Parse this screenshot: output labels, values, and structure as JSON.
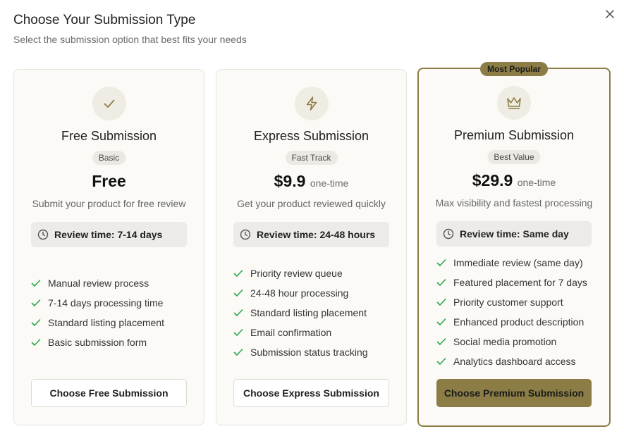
{
  "dialog": {
    "title": "Choose Your Submission Type",
    "subtitle": "Select the submission option that best fits your needs",
    "close_icon": "close-icon"
  },
  "colors": {
    "accent": "#8b7d45",
    "check": "#2aa84a",
    "card_bg": "#fbfaf7"
  },
  "plans": [
    {
      "icon": "check-icon",
      "name": "Free Submission",
      "badge": "Basic",
      "price": "Free",
      "price_suffix": "",
      "description": "Submit your product for free review",
      "review_time": "Review time: 7-14 days",
      "features": [
        "Manual review process",
        "7-14 days processing time",
        "Standard listing placement",
        "Basic submission form"
      ],
      "cta": "Choose Free Submission"
    },
    {
      "icon": "lightning-icon",
      "name": "Express Submission",
      "badge": "Fast Track",
      "price": "$9.9",
      "price_suffix": "one-time",
      "description": "Get your product reviewed quickly",
      "review_time": "Review time: 24-48 hours",
      "features": [
        "Priority review queue",
        "24-48 hour processing",
        "Standard listing placement",
        "Email confirmation",
        "Submission status tracking"
      ],
      "cta": "Choose Express Submission"
    },
    {
      "icon": "crown-icon",
      "name": "Premium Submission",
      "badge": "Best Value",
      "ribbon": "Most Popular",
      "price": "$29.9",
      "price_suffix": "one-time",
      "description": "Max visibility and fastest processing",
      "review_time": "Review time: Same day",
      "features": [
        "Immediate review (same day)",
        "Featured placement for 7 days",
        "Priority customer support",
        "Enhanced product description",
        "Social media promotion",
        "Analytics dashboard access"
      ],
      "cta": "Choose Premium Submission"
    }
  ]
}
